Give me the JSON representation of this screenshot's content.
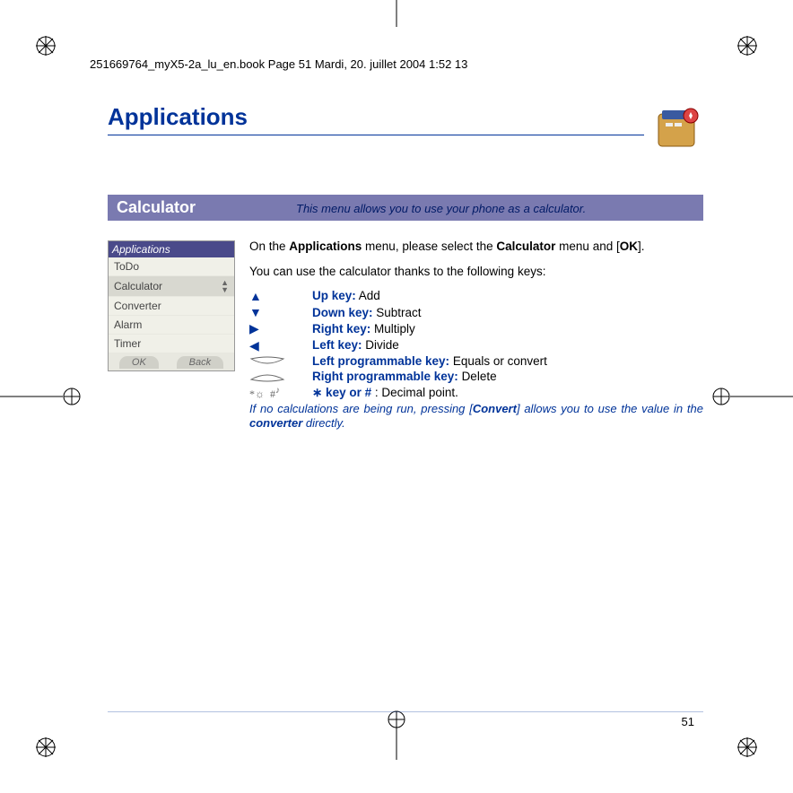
{
  "header": "251669764_myX5-2a_lu_en.book  Page 51  Mardi, 20. juillet 2004  1:52 13",
  "chapter_title": "Applications",
  "banner": {
    "title": "Calculator",
    "desc": "This menu allows you to use your phone as a calculator."
  },
  "phone": {
    "header": "Applications",
    "items": [
      "ToDo",
      "Calculator",
      "Converter",
      "Alarm",
      "Timer"
    ],
    "selected_index": 1,
    "soft_left": "OK",
    "soft_right": "Back"
  },
  "body": {
    "p1_pre": "On the ",
    "p1_b1": "Applications",
    "p1_mid": " menu, please select the ",
    "p1_b2": "Calculator",
    "p1_post": " menu and [",
    "p1_b3": "OK",
    "p1_end": "].",
    "p2": "You can use the calculator thanks to the following keys:"
  },
  "keys": [
    {
      "icon": "up",
      "label": "Up key:",
      "desc": "Add"
    },
    {
      "icon": "down",
      "label": "Down key:",
      "desc": "Subtract"
    },
    {
      "icon": "right",
      "label": "Right key:",
      "desc": "Multiply"
    },
    {
      "icon": "left",
      "label": "Left key:",
      "desc": "Divide"
    },
    {
      "icon": "skL",
      "label": "Left programmable key:",
      "desc": "Equals or convert"
    },
    {
      "icon": "skR",
      "label": "Right programmable key:",
      "desc": "Delete"
    },
    {
      "icon": "star",
      "label": "∗ key or #",
      "desc": ": Decimal point."
    }
  ],
  "footnote": {
    "pre": "If no calculations are being run, pressing [",
    "b1": "Convert",
    "mid": "] allows you to use the value in the ",
    "b2": "converter",
    "post": " directly."
  },
  "page_number": "51"
}
